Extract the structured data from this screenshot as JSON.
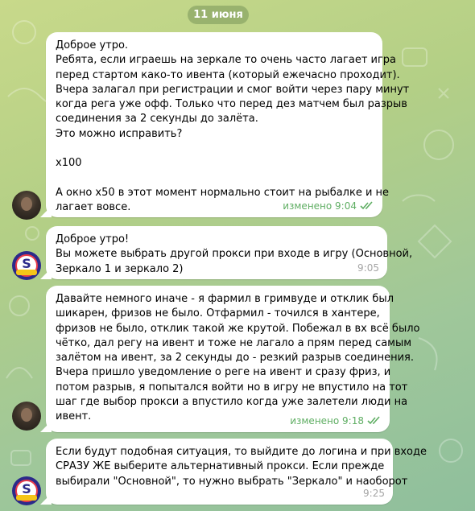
{
  "date_label": "11 июня",
  "messages": [
    {
      "lines": [
        "Доброе утро.",
        "Ребята, если играешь на зеркале то очень часто лагает игра",
        "перед стартом како-то ивента (который ежечасно проходит).",
        "Вчера залагал при регистрации и смог войти через пару минут",
        "когда рега уже офф. Только что перед дез матчем был разрыв",
        "соединения за 2 секунды до залёта.",
        "Это можно исправить?",
        "",
        "x100",
        "",
        "А окно x50 в этот момент нормально стоит на рыбалке и не",
        "лагает вовсе."
      ],
      "meta": "изменено 9:04"
    },
    {
      "lines": [
        "Доброе утро!",
        "Вы можете выбрать другой прокси при входе в игру (Основной,",
        "Зеркало 1 и зеркало 2)"
      ],
      "meta": "9:05"
    },
    {
      "lines": [
        "Давайте немного иначе - я фармил в гримвуде и отклик был",
        "шикарен, фризов не было. Отфармил - точился в хантере,",
        "фризов не было, отклик такой же крутой. Побежал в вх всё было",
        "чётко, дал регу на ивент и тоже не лагало а прям перед самым",
        "залётом на ивент, за 2 секунды до - резкий разрыв соединения.",
        "Вчера пришло уведомление о реге на ивент и сразу фриз, и",
        "потом разрыв, я попытался войти но в игру не впустило на тот",
        "шаг где выбор прокси а впустило когда уже залетели люди на",
        "ивент."
      ],
      "meta": "изменено 9:18"
    },
    {
      "lines": [
        "Если будут подобная ситуация, то выйдите до логина и при входе",
        "СРАЗУ ЖЕ выберите альтернативный прокси. Если прежде",
        "выбирали \"Основной\", то нужно выбрать \"Зеркало\" и наоборот"
      ],
      "meta": "9:25"
    }
  ],
  "bot_avatar_letter": "S",
  "colors": {
    "read_check": "#5fae63",
    "bubble": "#ffffff",
    "bot_avatar_bg": "#2b2a8a"
  },
  "icons": [
    "double-check-icon",
    "user-avatar",
    "bot-avatar"
  ]
}
